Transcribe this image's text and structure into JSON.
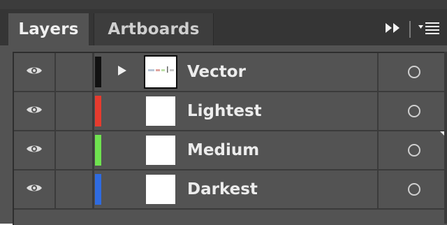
{
  "tabs": [
    {
      "label": "Layers",
      "active": true
    },
    {
      "label": "Artboards",
      "active": false
    }
  ],
  "controls": {
    "expand_icon": "double-chevron-right-icon",
    "menu_icon": "panel-menu-icon"
  },
  "layers": [
    {
      "name": "Vector",
      "color": "#111111",
      "visible": true,
      "expandable": true,
      "selected_thumb": true
    },
    {
      "name": "Lightest",
      "color": "#e63b2e",
      "visible": true,
      "expandable": false,
      "selected_thumb": false
    },
    {
      "name": "Medium",
      "color": "#6fe24f",
      "visible": true,
      "expandable": false,
      "selected_thumb": false
    },
    {
      "name": "Darkest",
      "color": "#2f6be0",
      "visible": true,
      "expandable": false,
      "selected_thumb": false
    }
  ],
  "colors": {
    "panel_bg": "#535353",
    "tabbar_bg": "#353535",
    "text": "#ececec"
  }
}
